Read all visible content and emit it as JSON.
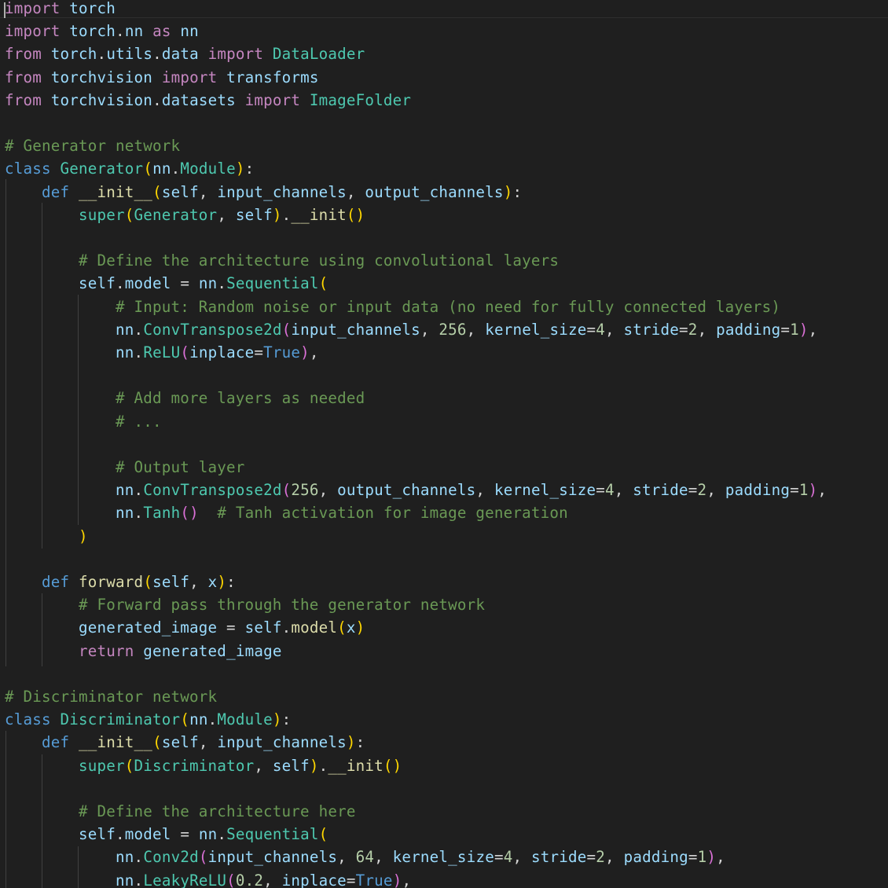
{
  "editor": {
    "language": "python",
    "lines": [
      [
        [
          "kw",
          "import"
        ],
        [
          "pl",
          " "
        ],
        [
          "id",
          "torch"
        ]
      ],
      [
        [
          "kw",
          "import"
        ],
        [
          "pl",
          " "
        ],
        [
          "id",
          "torch"
        ],
        [
          "pl",
          "."
        ],
        [
          "id",
          "nn"
        ],
        [
          "pl",
          " "
        ],
        [
          "kw",
          "as"
        ],
        [
          "pl",
          " "
        ],
        [
          "id",
          "nn"
        ]
      ],
      [
        [
          "kw",
          "from"
        ],
        [
          "pl",
          " "
        ],
        [
          "id",
          "torch"
        ],
        [
          "pl",
          "."
        ],
        [
          "id",
          "utils"
        ],
        [
          "pl",
          "."
        ],
        [
          "id",
          "data"
        ],
        [
          "pl",
          " "
        ],
        [
          "kw",
          "import"
        ],
        [
          "pl",
          " "
        ],
        [
          "cls",
          "DataLoader"
        ]
      ],
      [
        [
          "kw",
          "from"
        ],
        [
          "pl",
          " "
        ],
        [
          "id",
          "torchvision"
        ],
        [
          "pl",
          " "
        ],
        [
          "kw",
          "import"
        ],
        [
          "pl",
          " "
        ],
        [
          "id",
          "transforms"
        ]
      ],
      [
        [
          "kw",
          "from"
        ],
        [
          "pl",
          " "
        ],
        [
          "id",
          "torchvision"
        ],
        [
          "pl",
          "."
        ],
        [
          "id",
          "datasets"
        ],
        [
          "pl",
          " "
        ],
        [
          "kw",
          "import"
        ],
        [
          "pl",
          " "
        ],
        [
          "cls",
          "ImageFolder"
        ]
      ],
      [],
      [
        [
          "cm",
          "# Generator network"
        ]
      ],
      [
        [
          "kwb",
          "class"
        ],
        [
          "pl",
          " "
        ],
        [
          "cls",
          "Generator"
        ],
        [
          "p1",
          "("
        ],
        [
          "id",
          "nn"
        ],
        [
          "pl",
          "."
        ],
        [
          "cls",
          "Module"
        ],
        [
          "p1",
          ")"
        ],
        [
          "pl",
          ":"
        ]
      ],
      [
        [
          "pl",
          "    "
        ],
        [
          "kwb",
          "def"
        ],
        [
          "pl",
          " "
        ],
        [
          "fn",
          "__init__"
        ],
        [
          "p1",
          "("
        ],
        [
          "id",
          "self"
        ],
        [
          "pl",
          ", "
        ],
        [
          "id",
          "input_channels"
        ],
        [
          "pl",
          ", "
        ],
        [
          "id",
          "output_channels"
        ],
        [
          "p1",
          ")"
        ],
        [
          "pl",
          ":"
        ]
      ],
      [
        [
          "pl",
          "        "
        ],
        [
          "cls",
          "super"
        ],
        [
          "p1",
          "("
        ],
        [
          "cls",
          "Generator"
        ],
        [
          "pl",
          ", "
        ],
        [
          "id",
          "self"
        ],
        [
          "p1",
          ")"
        ],
        [
          "pl",
          "."
        ],
        [
          "fn",
          "__init"
        ],
        [
          "p1",
          "()"
        ]
      ],
      [],
      [
        [
          "pl",
          "        "
        ],
        [
          "cm",
          "# Define the architecture using convolutional layers"
        ]
      ],
      [
        [
          "pl",
          "        "
        ],
        [
          "id",
          "self"
        ],
        [
          "pl",
          "."
        ],
        [
          "id",
          "model"
        ],
        [
          "pl",
          " = "
        ],
        [
          "id",
          "nn"
        ],
        [
          "pl",
          "."
        ],
        [
          "cls",
          "Sequential"
        ],
        [
          "p1",
          "("
        ]
      ],
      [
        [
          "pl",
          "            "
        ],
        [
          "cm",
          "# Input: Random noise or input data (no need for fully connected layers)"
        ]
      ],
      [
        [
          "pl",
          "            "
        ],
        [
          "id",
          "nn"
        ],
        [
          "pl",
          "."
        ],
        [
          "cls",
          "ConvTranspose2d"
        ],
        [
          "p2",
          "("
        ],
        [
          "id",
          "input_channels"
        ],
        [
          "pl",
          ", "
        ],
        [
          "num",
          "256"
        ],
        [
          "pl",
          ", "
        ],
        [
          "id",
          "kernel_size"
        ],
        [
          "pl",
          "="
        ],
        [
          "num",
          "4"
        ],
        [
          "pl",
          ", "
        ],
        [
          "id",
          "stride"
        ],
        [
          "pl",
          "="
        ],
        [
          "num",
          "2"
        ],
        [
          "pl",
          ", "
        ],
        [
          "id",
          "padding"
        ],
        [
          "pl",
          "="
        ],
        [
          "num",
          "1"
        ],
        [
          "p2",
          ")"
        ],
        [
          "pl",
          ","
        ]
      ],
      [
        [
          "pl",
          "            "
        ],
        [
          "id",
          "nn"
        ],
        [
          "pl",
          "."
        ],
        [
          "cls",
          "ReLU"
        ],
        [
          "p2",
          "("
        ],
        [
          "id",
          "inplace"
        ],
        [
          "pl",
          "="
        ],
        [
          "kwb",
          "True"
        ],
        [
          "p2",
          ")"
        ],
        [
          "pl",
          ","
        ]
      ],
      [],
      [
        [
          "pl",
          "            "
        ],
        [
          "cm",
          "# Add more layers as needed"
        ]
      ],
      [
        [
          "pl",
          "            "
        ],
        [
          "cm",
          "# ..."
        ]
      ],
      [],
      [
        [
          "pl",
          "            "
        ],
        [
          "cm",
          "# Output layer"
        ]
      ],
      [
        [
          "pl",
          "            "
        ],
        [
          "id",
          "nn"
        ],
        [
          "pl",
          "."
        ],
        [
          "cls",
          "ConvTranspose2d"
        ],
        [
          "p2",
          "("
        ],
        [
          "num",
          "256"
        ],
        [
          "pl",
          ", "
        ],
        [
          "id",
          "output_channels"
        ],
        [
          "pl",
          ", "
        ],
        [
          "id",
          "kernel_size"
        ],
        [
          "pl",
          "="
        ],
        [
          "num",
          "4"
        ],
        [
          "pl",
          ", "
        ],
        [
          "id",
          "stride"
        ],
        [
          "pl",
          "="
        ],
        [
          "num",
          "2"
        ],
        [
          "pl",
          ", "
        ],
        [
          "id",
          "padding"
        ],
        [
          "pl",
          "="
        ],
        [
          "num",
          "1"
        ],
        [
          "p2",
          ")"
        ],
        [
          "pl",
          ","
        ]
      ],
      [
        [
          "pl",
          "            "
        ],
        [
          "id",
          "nn"
        ],
        [
          "pl",
          "."
        ],
        [
          "cls",
          "Tanh"
        ],
        [
          "p2",
          "()"
        ],
        [
          "pl",
          "  "
        ],
        [
          "cm",
          "# Tanh activation for image generation"
        ]
      ],
      [
        [
          "pl",
          "        "
        ],
        [
          "p1",
          ")"
        ]
      ],
      [],
      [
        [
          "pl",
          "    "
        ],
        [
          "kwb",
          "def"
        ],
        [
          "pl",
          " "
        ],
        [
          "fn",
          "forward"
        ],
        [
          "p1",
          "("
        ],
        [
          "id",
          "self"
        ],
        [
          "pl",
          ", "
        ],
        [
          "id",
          "x"
        ],
        [
          "p1",
          ")"
        ],
        [
          "pl",
          ":"
        ]
      ],
      [
        [
          "pl",
          "        "
        ],
        [
          "cm",
          "# Forward pass through the generator network"
        ]
      ],
      [
        [
          "pl",
          "        "
        ],
        [
          "id",
          "generated_image"
        ],
        [
          "pl",
          " = "
        ],
        [
          "id",
          "self"
        ],
        [
          "pl",
          "."
        ],
        [
          "fn",
          "model"
        ],
        [
          "p1",
          "("
        ],
        [
          "id",
          "x"
        ],
        [
          "p1",
          ")"
        ]
      ],
      [
        [
          "pl",
          "        "
        ],
        [
          "kw",
          "return"
        ],
        [
          "pl",
          " "
        ],
        [
          "id",
          "generated_image"
        ]
      ],
      [],
      [
        [
          "cm",
          "# Discriminator network"
        ]
      ],
      [
        [
          "kwb",
          "class"
        ],
        [
          "pl",
          " "
        ],
        [
          "cls",
          "Discriminator"
        ],
        [
          "p1",
          "("
        ],
        [
          "id",
          "nn"
        ],
        [
          "pl",
          "."
        ],
        [
          "cls",
          "Module"
        ],
        [
          "p1",
          ")"
        ],
        [
          "pl",
          ":"
        ]
      ],
      [
        [
          "pl",
          "    "
        ],
        [
          "kwb",
          "def"
        ],
        [
          "pl",
          " "
        ],
        [
          "fn",
          "__init__"
        ],
        [
          "p1",
          "("
        ],
        [
          "id",
          "self"
        ],
        [
          "pl",
          ", "
        ],
        [
          "id",
          "input_channels"
        ],
        [
          "p1",
          ")"
        ],
        [
          "pl",
          ":"
        ]
      ],
      [
        [
          "pl",
          "        "
        ],
        [
          "cls",
          "super"
        ],
        [
          "p1",
          "("
        ],
        [
          "cls",
          "Discriminator"
        ],
        [
          "pl",
          ", "
        ],
        [
          "id",
          "self"
        ],
        [
          "p1",
          ")"
        ],
        [
          "pl",
          "."
        ],
        [
          "fn",
          "__init"
        ],
        [
          "p1",
          "()"
        ]
      ],
      [],
      [
        [
          "pl",
          "        "
        ],
        [
          "cm",
          "# Define the architecture here"
        ]
      ],
      [
        [
          "pl",
          "        "
        ],
        [
          "id",
          "self"
        ],
        [
          "pl",
          "."
        ],
        [
          "id",
          "model"
        ],
        [
          "pl",
          " = "
        ],
        [
          "id",
          "nn"
        ],
        [
          "pl",
          "."
        ],
        [
          "cls",
          "Sequential"
        ],
        [
          "p1",
          "("
        ]
      ],
      [
        [
          "pl",
          "            "
        ],
        [
          "id",
          "nn"
        ],
        [
          "pl",
          "."
        ],
        [
          "cls",
          "Conv2d"
        ],
        [
          "p2",
          "("
        ],
        [
          "id",
          "input_channels"
        ],
        [
          "pl",
          ", "
        ],
        [
          "num",
          "64"
        ],
        [
          "pl",
          ", "
        ],
        [
          "id",
          "kernel_size"
        ],
        [
          "pl",
          "="
        ],
        [
          "num",
          "4"
        ],
        [
          "pl",
          ", "
        ],
        [
          "id",
          "stride"
        ],
        [
          "pl",
          "="
        ],
        [
          "num",
          "2"
        ],
        [
          "pl",
          ", "
        ],
        [
          "id",
          "padding"
        ],
        [
          "pl",
          "="
        ],
        [
          "num",
          "1"
        ],
        [
          "p2",
          ")"
        ],
        [
          "pl",
          ","
        ]
      ],
      [
        [
          "pl",
          "            "
        ],
        [
          "id",
          "nn"
        ],
        [
          "pl",
          "."
        ],
        [
          "cls",
          "LeakyReLU"
        ],
        [
          "p2",
          "("
        ],
        [
          "num",
          "0.2"
        ],
        [
          "pl",
          ", "
        ],
        [
          "id",
          "inplace"
        ],
        [
          "pl",
          "="
        ],
        [
          "kwb",
          "True"
        ],
        [
          "p2",
          ")"
        ],
        [
          "pl",
          ","
        ]
      ]
    ]
  }
}
